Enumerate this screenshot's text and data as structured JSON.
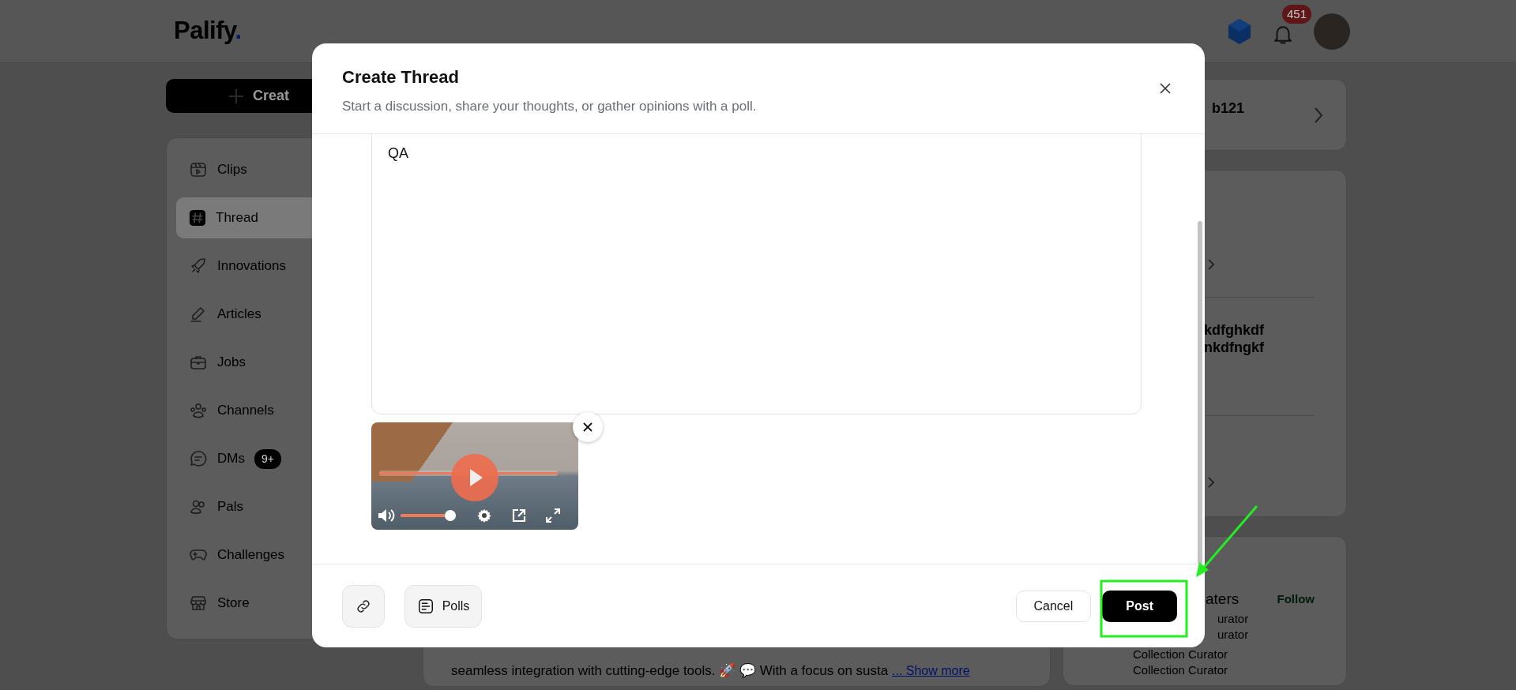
{
  "header": {
    "logo": "Palify",
    "logo_mark": ".",
    "notification_count": "451"
  },
  "sidebar": {
    "create_button": "Creat",
    "items": [
      {
        "label": "Clips",
        "selected": false
      },
      {
        "label": "Thread",
        "selected": true
      },
      {
        "label": "Innovations",
        "selected": false
      },
      {
        "label": "Articles",
        "selected": false
      },
      {
        "label": "Jobs",
        "selected": false
      },
      {
        "label": "Channels",
        "selected": false
      },
      {
        "label": "DMs",
        "selected": false,
        "badge": "9+"
      },
      {
        "label": "Pals",
        "selected": false
      },
      {
        "label": "Challenges",
        "selected": false
      },
      {
        "label": "Store",
        "selected": false
      }
    ]
  },
  "feed": {
    "post_excerpt": "seamless integration with cutting-edge tools. 🚀 💬 With a focus on susta",
    "show_more": "... Show more"
  },
  "right_panel": {
    "profile_name": "b121",
    "post_lines": [
      "kdfghkdf",
      "nkdfngkf"
    ],
    "suggestion": {
      "name": "aters",
      "action": "Follow",
      "roles": [
        "urator",
        "urator",
        "Collection Curator",
        "Collection Curator"
      ]
    }
  },
  "modal": {
    "title": "Create Thread",
    "subtitle": "Start a discussion, share your thoughts, or gather opinions with a poll.",
    "body_text": "QA",
    "attachment": {
      "kind": "video",
      "progress": {
        "level": 1
      },
      "volume": {
        "level": 1
      }
    },
    "polls_button": "Polls",
    "cancel_button": "Cancel",
    "post_button": "Post"
  }
}
